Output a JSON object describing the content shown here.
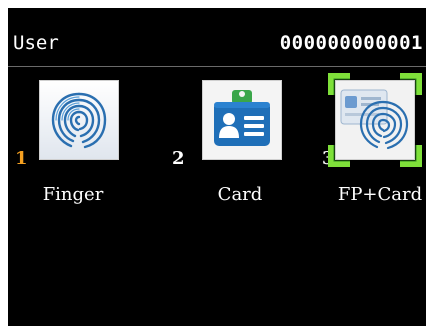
{
  "header": {
    "title": "User",
    "user_id": "000000000001"
  },
  "options": [
    {
      "number": "1",
      "label": "Finger",
      "icon": "fingerprint-icon",
      "number_color": "#f5a020"
    },
    {
      "number": "2",
      "label": "Card",
      "icon": "id-card-icon",
      "number_color": "#ffffff"
    },
    {
      "number": "3",
      "label": "FP+Card",
      "icon": "fingerprint-card-icon",
      "number_color": "#ffffff"
    }
  ],
  "selected_option": "3",
  "colors": {
    "background": "#000000",
    "text": "#ffffff",
    "accent_number": "#f5a020",
    "selection": "#7fe03a",
    "card_blue": "#1f6fb8",
    "card_green": "#3aa64a"
  }
}
